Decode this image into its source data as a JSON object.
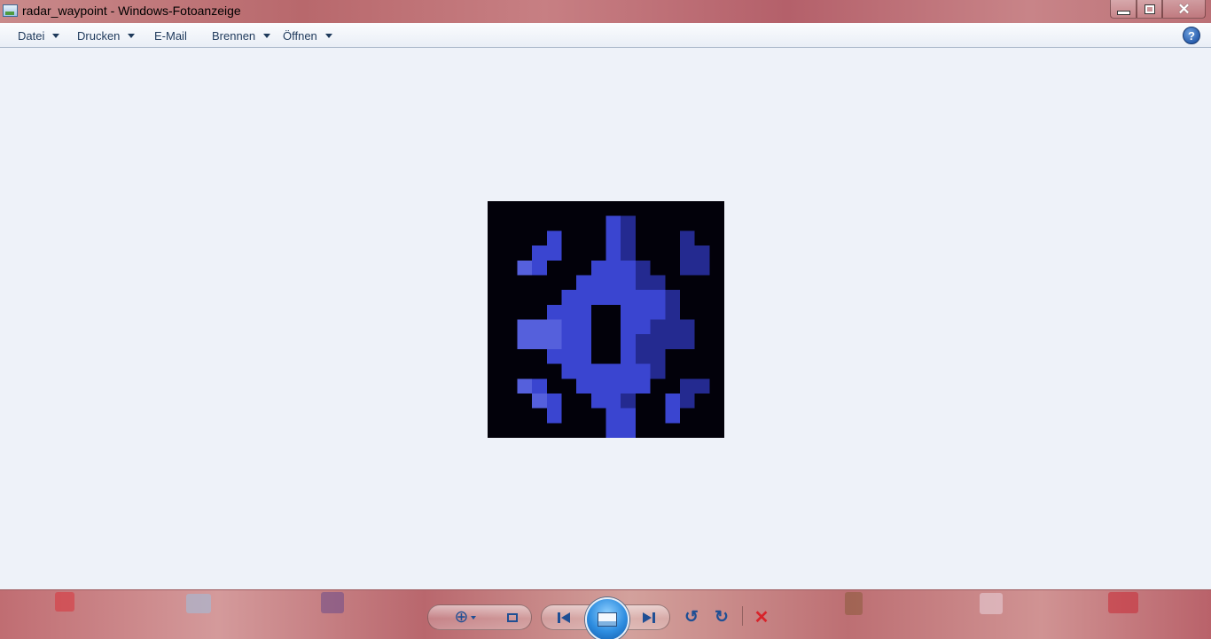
{
  "window": {
    "title": "radar_waypoint - Windows-Fotoanzeige",
    "app_icon": "photo-viewer-icon",
    "caption_buttons": {
      "minimize_icon": "minimize-icon",
      "maximize_icon": "restore-icon",
      "close_icon": "close-icon",
      "close_glyph": "✕"
    }
  },
  "menubar": {
    "items": [
      {
        "label": "Datei",
        "has_dropdown": true
      },
      {
        "label": "Drucken",
        "has_dropdown": true
      },
      {
        "label": "E-Mail",
        "has_dropdown": false
      },
      {
        "label": "Brennen",
        "has_dropdown": true
      },
      {
        "label": "Öffnen",
        "has_dropdown": true
      }
    ],
    "help_label": "?"
  },
  "photo": {
    "name": "radar_waypoint",
    "background_color": "#02010a",
    "primary_color": "#3a45d0",
    "light_color": "#5560dc",
    "dark_color": "#242a90"
  },
  "controls": {
    "zoom_icon": "zoom-icon",
    "zoom_glyph": "⊕",
    "fit_icon": "actual-size-icon",
    "previous_icon": "previous-icon",
    "slideshow_icon": "slideshow-icon",
    "next_icon": "next-icon",
    "rotate_left_icon": "rotate-counterclockwise-icon",
    "rotate_left_glyph": "↺",
    "rotate_right_icon": "rotate-clockwise-icon",
    "rotate_right_glyph": "↻",
    "delete_icon": "delete-icon",
    "delete_glyph": "✕"
  },
  "colors": {
    "menu_text": "#1e395b",
    "view_background": "#eef2f9",
    "accent": "#1f4f94",
    "delete_red": "#d8232a"
  }
}
